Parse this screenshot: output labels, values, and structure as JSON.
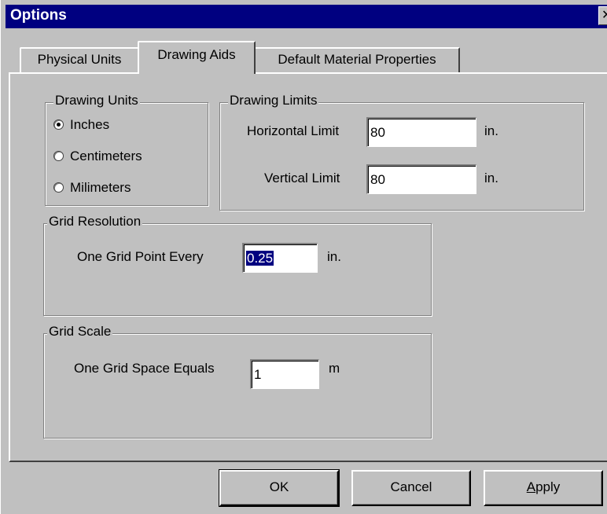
{
  "window": {
    "title": "Options",
    "close_glyph": "✕"
  },
  "tabs": [
    {
      "label": "Physical Units",
      "active": false
    },
    {
      "label": "Drawing Aids",
      "active": true
    },
    {
      "label": "Default Material Properties",
      "active": false
    }
  ],
  "drawing_units": {
    "title": "Drawing Units",
    "options": [
      {
        "label": "Inches",
        "checked": true
      },
      {
        "label": "Centimeters",
        "checked": false
      },
      {
        "label": "Milimeters",
        "checked": false
      }
    ]
  },
  "drawing_limits": {
    "title": "Drawing Limits",
    "horizontal": {
      "label": "Horizontal Limit",
      "value": "80",
      "unit": "in."
    },
    "vertical": {
      "label": "Vertical Limit",
      "value": "80",
      "unit": "in."
    }
  },
  "grid_resolution": {
    "title": "Grid Resolution",
    "label": "One Grid Point Every",
    "value": "0.25",
    "unit": "in."
  },
  "grid_scale": {
    "title": "Grid Scale",
    "label": "One Grid Space Equals",
    "value": "1",
    "unit": "m"
  },
  "buttons": {
    "ok": "OK",
    "cancel": "Cancel",
    "apply_accel": "A",
    "apply_rest": "pply"
  }
}
